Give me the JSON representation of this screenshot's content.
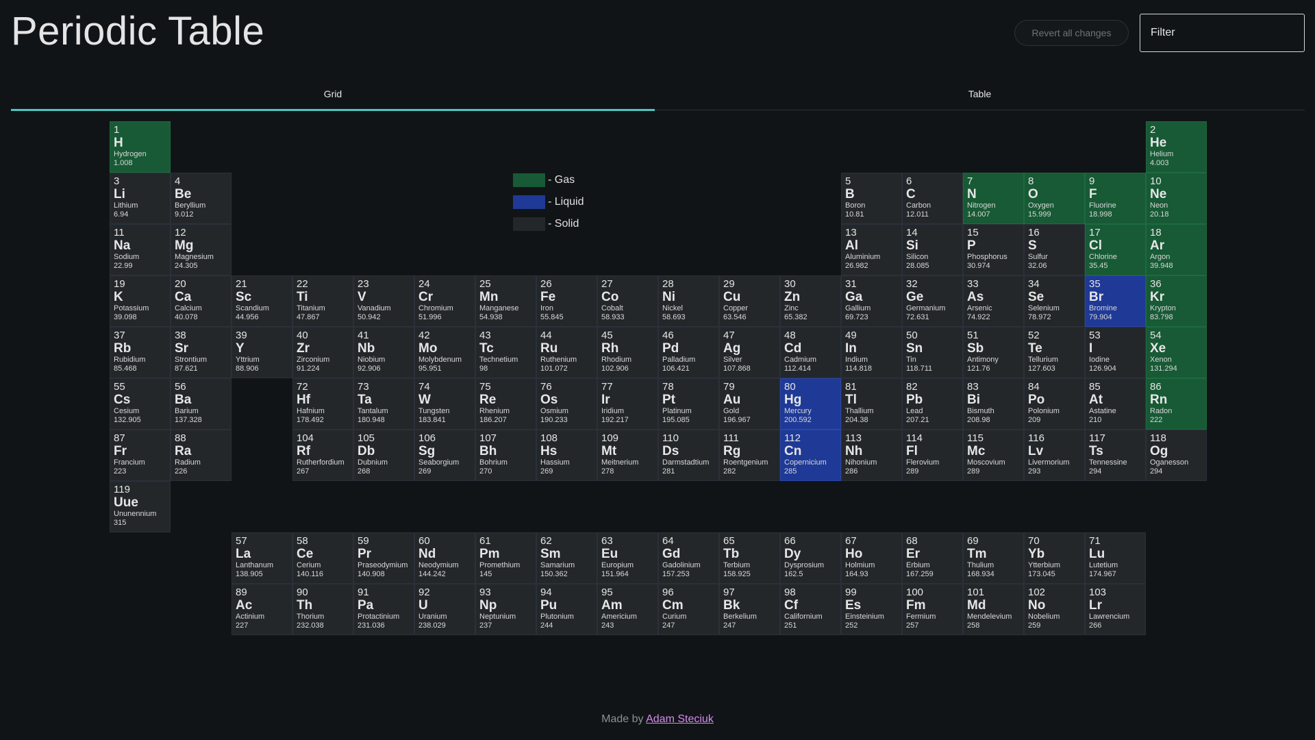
{
  "header": {
    "title": "Periodic Table",
    "revert_label": "Revert all changes",
    "filter_placeholder": "Filter"
  },
  "tabs": [
    {
      "label": "Grid",
      "active": true
    },
    {
      "label": "Table",
      "active": false
    }
  ],
  "legend": [
    {
      "label": "- Gas",
      "color": "#175a35"
    },
    {
      "label": "- Liquid",
      "color": "#1f3996"
    },
    {
      "label": "- Solid",
      "color": "#24272a"
    }
  ],
  "colors": {
    "gas": "#175a35",
    "liquid": "#1f3996",
    "solid": "#24272a",
    "accent": "#4dc6c0",
    "link": "#d68bf0"
  },
  "elements": [
    {
      "n": "1",
      "s": "H",
      "name": "Hydrogen",
      "m": "1.008",
      "state": "gas"
    },
    {
      "n": "2",
      "s": "He",
      "name": "Helium",
      "m": "4.003",
      "state": "gas"
    },
    {
      "n": "3",
      "s": "Li",
      "name": "Lithium",
      "m": "6.94",
      "state": "solid"
    },
    {
      "n": "4",
      "s": "Be",
      "name": "Beryllium",
      "m": "9.012",
      "state": "solid"
    },
    {
      "n": "5",
      "s": "B",
      "name": "Boron",
      "m": "10.81",
      "state": "solid"
    },
    {
      "n": "6",
      "s": "C",
      "name": "Carbon",
      "m": "12.011",
      "state": "solid"
    },
    {
      "n": "7",
      "s": "N",
      "name": "Nitrogen",
      "m": "14.007",
      "state": "gas"
    },
    {
      "n": "8",
      "s": "O",
      "name": "Oxygen",
      "m": "15.999",
      "state": "gas"
    },
    {
      "n": "9",
      "s": "F",
      "name": "Fluorine",
      "m": "18.998",
      "state": "gas"
    },
    {
      "n": "10",
      "s": "Ne",
      "name": "Neon",
      "m": "20.18",
      "state": "gas"
    },
    {
      "n": "11",
      "s": "Na",
      "name": "Sodium",
      "m": "22.99",
      "state": "solid"
    },
    {
      "n": "12",
      "s": "Mg",
      "name": "Magnesium",
      "m": "24.305",
      "state": "solid"
    },
    {
      "n": "13",
      "s": "Al",
      "name": "Aluminium",
      "m": "26.982",
      "state": "solid"
    },
    {
      "n": "14",
      "s": "Si",
      "name": "Silicon",
      "m": "28.085",
      "state": "solid"
    },
    {
      "n": "15",
      "s": "P",
      "name": "Phosphorus",
      "m": "30.974",
      "state": "solid"
    },
    {
      "n": "16",
      "s": "S",
      "name": "Sulfur",
      "m": "32.06",
      "state": "solid"
    },
    {
      "n": "17",
      "s": "Cl",
      "name": "Chlorine",
      "m": "35.45",
      "state": "gas"
    },
    {
      "n": "18",
      "s": "Ar",
      "name": "Argon",
      "m": "39.948",
      "state": "gas"
    },
    {
      "n": "19",
      "s": "K",
      "name": "Potassium",
      "m": "39.098",
      "state": "solid"
    },
    {
      "n": "20",
      "s": "Ca",
      "name": "Calcium",
      "m": "40.078",
      "state": "solid"
    },
    {
      "n": "21",
      "s": "Sc",
      "name": "Scandium",
      "m": "44.956",
      "state": "solid"
    },
    {
      "n": "22",
      "s": "Ti",
      "name": "Titanium",
      "m": "47.867",
      "state": "solid"
    },
    {
      "n": "23",
      "s": "V",
      "name": "Vanadium",
      "m": "50.942",
      "state": "solid"
    },
    {
      "n": "24",
      "s": "Cr",
      "name": "Chromium",
      "m": "51.996",
      "state": "solid"
    },
    {
      "n": "25",
      "s": "Mn",
      "name": "Manganese",
      "m": "54.938",
      "state": "solid"
    },
    {
      "n": "26",
      "s": "Fe",
      "name": "Iron",
      "m": "55.845",
      "state": "solid"
    },
    {
      "n": "27",
      "s": "Co",
      "name": "Cobalt",
      "m": "58.933",
      "state": "solid"
    },
    {
      "n": "28",
      "s": "Ni",
      "name": "Nickel",
      "m": "58.693",
      "state": "solid"
    },
    {
      "n": "29",
      "s": "Cu",
      "name": "Copper",
      "m": "63.546",
      "state": "solid"
    },
    {
      "n": "30",
      "s": "Zn",
      "name": "Zinc",
      "m": "65.382",
      "state": "solid"
    },
    {
      "n": "31",
      "s": "Ga",
      "name": "Gallium",
      "m": "69.723",
      "state": "solid"
    },
    {
      "n": "32",
      "s": "Ge",
      "name": "Germanium",
      "m": "72.631",
      "state": "solid"
    },
    {
      "n": "33",
      "s": "As",
      "name": "Arsenic",
      "m": "74.922",
      "state": "solid"
    },
    {
      "n": "34",
      "s": "Se",
      "name": "Selenium",
      "m": "78.972",
      "state": "solid"
    },
    {
      "n": "35",
      "s": "Br",
      "name": "Bromine",
      "m": "79.904",
      "state": "liquid"
    },
    {
      "n": "36",
      "s": "Kr",
      "name": "Krypton",
      "m": "83.798",
      "state": "gas"
    },
    {
      "n": "37",
      "s": "Rb",
      "name": "Rubidium",
      "m": "85.468",
      "state": "solid"
    },
    {
      "n": "38",
      "s": "Sr",
      "name": "Strontium",
      "m": "87.621",
      "state": "solid"
    },
    {
      "n": "39",
      "s": "Y",
      "name": "Yttrium",
      "m": "88.906",
      "state": "solid"
    },
    {
      "n": "40",
      "s": "Zr",
      "name": "Zirconium",
      "m": "91.224",
      "state": "solid"
    },
    {
      "n": "41",
      "s": "Nb",
      "name": "Niobium",
      "m": "92.906",
      "state": "solid"
    },
    {
      "n": "42",
      "s": "Mo",
      "name": "Molybdenum",
      "m": "95.951",
      "state": "solid"
    },
    {
      "n": "43",
      "s": "Tc",
      "name": "Technetium",
      "m": "98",
      "state": "solid"
    },
    {
      "n": "44",
      "s": "Ru",
      "name": "Ruthenium",
      "m": "101.072",
      "state": "solid"
    },
    {
      "n": "45",
      "s": "Rh",
      "name": "Rhodium",
      "m": "102.906",
      "state": "solid"
    },
    {
      "n": "46",
      "s": "Pd",
      "name": "Palladium",
      "m": "106.421",
      "state": "solid"
    },
    {
      "n": "47",
      "s": "Ag",
      "name": "Silver",
      "m": "107.868",
      "state": "solid"
    },
    {
      "n": "48",
      "s": "Cd",
      "name": "Cadmium",
      "m": "112.414",
      "state": "solid"
    },
    {
      "n": "49",
      "s": "In",
      "name": "Indium",
      "m": "114.818",
      "state": "solid"
    },
    {
      "n": "50",
      "s": "Sn",
      "name": "Tin",
      "m": "118.711",
      "state": "solid"
    },
    {
      "n": "51",
      "s": "Sb",
      "name": "Antimony",
      "m": "121.76",
      "state": "solid"
    },
    {
      "n": "52",
      "s": "Te",
      "name": "Tellurium",
      "m": "127.603",
      "state": "solid"
    },
    {
      "n": "53",
      "s": "I",
      "name": "Iodine",
      "m": "126.904",
      "state": "solid"
    },
    {
      "n": "54",
      "s": "Xe",
      "name": "Xenon",
      "m": "131.294",
      "state": "gas"
    },
    {
      "n": "55",
      "s": "Cs",
      "name": "Cesium",
      "m": "132.905",
      "state": "solid"
    },
    {
      "n": "56",
      "s": "Ba",
      "name": "Barium",
      "m": "137.328",
      "state": "solid"
    },
    {
      "n": "72",
      "s": "Hf",
      "name": "Hafnium",
      "m": "178.492",
      "state": "solid"
    },
    {
      "n": "73",
      "s": "Ta",
      "name": "Tantalum",
      "m": "180.948",
      "state": "solid"
    },
    {
      "n": "74",
      "s": "W",
      "name": "Tungsten",
      "m": "183.841",
      "state": "solid"
    },
    {
      "n": "75",
      "s": "Re",
      "name": "Rhenium",
      "m": "186.207",
      "state": "solid"
    },
    {
      "n": "76",
      "s": "Os",
      "name": "Osmium",
      "m": "190.233",
      "state": "solid"
    },
    {
      "n": "77",
      "s": "Ir",
      "name": "Iridium",
      "m": "192.217",
      "state": "solid"
    },
    {
      "n": "78",
      "s": "Pt",
      "name": "Platinum",
      "m": "195.085",
      "state": "solid"
    },
    {
      "n": "79",
      "s": "Au",
      "name": "Gold",
      "m": "196.967",
      "state": "solid"
    },
    {
      "n": "80",
      "s": "Hg",
      "name": "Mercury",
      "m": "200.592",
      "state": "liquid"
    },
    {
      "n": "81",
      "s": "Tl",
      "name": "Thallium",
      "m": "204.38",
      "state": "solid"
    },
    {
      "n": "82",
      "s": "Pb",
      "name": "Lead",
      "m": "207.21",
      "state": "solid"
    },
    {
      "n": "83",
      "s": "Bi",
      "name": "Bismuth",
      "m": "208.98",
      "state": "solid"
    },
    {
      "n": "84",
      "s": "Po",
      "name": "Polonium",
      "m": "209",
      "state": "solid"
    },
    {
      "n": "85",
      "s": "At",
      "name": "Astatine",
      "m": "210",
      "state": "solid"
    },
    {
      "n": "86",
      "s": "Rn",
      "name": "Radon",
      "m": "222",
      "state": "gas"
    },
    {
      "n": "87",
      "s": "Fr",
      "name": "Francium",
      "m": "223",
      "state": "solid"
    },
    {
      "n": "88",
      "s": "Ra",
      "name": "Radium",
      "m": "226",
      "state": "solid"
    },
    {
      "n": "104",
      "s": "Rf",
      "name": "Rutherfordium",
      "m": "267",
      "state": "solid"
    },
    {
      "n": "105",
      "s": "Db",
      "name": "Dubnium",
      "m": "268",
      "state": "solid"
    },
    {
      "n": "106",
      "s": "Sg",
      "name": "Seaborgium",
      "m": "269",
      "state": "solid"
    },
    {
      "n": "107",
      "s": "Bh",
      "name": "Bohrium",
      "m": "270",
      "state": "solid"
    },
    {
      "n": "108",
      "s": "Hs",
      "name": "Hassium",
      "m": "269",
      "state": "solid"
    },
    {
      "n": "109",
      "s": "Mt",
      "name": "Meitnerium",
      "m": "278",
      "state": "solid"
    },
    {
      "n": "110",
      "s": "Ds",
      "name": "Darmstadtium",
      "m": "281",
      "state": "solid"
    },
    {
      "n": "111",
      "s": "Rg",
      "name": "Roentgenium",
      "m": "282",
      "state": "solid"
    },
    {
      "n": "112",
      "s": "Cn",
      "name": "Copernicium",
      "m": "285",
      "state": "liquid"
    },
    {
      "n": "113",
      "s": "Nh",
      "name": "Nihonium",
      "m": "286",
      "state": "solid"
    },
    {
      "n": "114",
      "s": "Fl",
      "name": "Flerovium",
      "m": "289",
      "state": "solid"
    },
    {
      "n": "115",
      "s": "Mc",
      "name": "Moscovium",
      "m": "289",
      "state": "solid"
    },
    {
      "n": "116",
      "s": "Lv",
      "name": "Livermorium",
      "m": "293",
      "state": "solid"
    },
    {
      "n": "117",
      "s": "Ts",
      "name": "Tennessine",
      "m": "294",
      "state": "solid"
    },
    {
      "n": "118",
      "s": "Og",
      "name": "Oganesson",
      "m": "294",
      "state": "solid"
    },
    {
      "n": "119",
      "s": "Uue",
      "name": "Ununennium",
      "m": "315",
      "state": "solid"
    },
    {
      "n": "57",
      "s": "La",
      "name": "Lanthanum",
      "m": "138.905",
      "state": "solid"
    },
    {
      "n": "58",
      "s": "Ce",
      "name": "Cerium",
      "m": "140.116",
      "state": "solid"
    },
    {
      "n": "59",
      "s": "Pr",
      "name": "Praseodymium",
      "m": "140.908",
      "state": "solid"
    },
    {
      "n": "60",
      "s": "Nd",
      "name": "Neodymium",
      "m": "144.242",
      "state": "solid"
    },
    {
      "n": "61",
      "s": "Pm",
      "name": "Promethium",
      "m": "145",
      "state": "solid"
    },
    {
      "n": "62",
      "s": "Sm",
      "name": "Samarium",
      "m": "150.362",
      "state": "solid"
    },
    {
      "n": "63",
      "s": "Eu",
      "name": "Europium",
      "m": "151.964",
      "state": "solid"
    },
    {
      "n": "64",
      "s": "Gd",
      "name": "Gadolinium",
      "m": "157.253",
      "state": "solid"
    },
    {
      "n": "65",
      "s": "Tb",
      "name": "Terbium",
      "m": "158.925",
      "state": "solid"
    },
    {
      "n": "66",
      "s": "Dy",
      "name": "Dysprosium",
      "m": "162.5",
      "state": "solid"
    },
    {
      "n": "67",
      "s": "Ho",
      "name": "Holmium",
      "m": "164.93",
      "state": "solid"
    },
    {
      "n": "68",
      "s": "Er",
      "name": "Erbium",
      "m": "167.259",
      "state": "solid"
    },
    {
      "n": "69",
      "s": "Tm",
      "name": "Thulium",
      "m": "168.934",
      "state": "solid"
    },
    {
      "n": "70",
      "s": "Yb",
      "name": "Ytterbium",
      "m": "173.045",
      "state": "solid"
    },
    {
      "n": "71",
      "s": "Lu",
      "name": "Lutetium",
      "m": "174.967",
      "state": "solid"
    },
    {
      "n": "89",
      "s": "Ac",
      "name": "Actinium",
      "m": "227",
      "state": "solid"
    },
    {
      "n": "90",
      "s": "Th",
      "name": "Thorium",
      "m": "232.038",
      "state": "solid"
    },
    {
      "n": "91",
      "s": "Pa",
      "name": "Protactinium",
      "m": "231.036",
      "state": "solid"
    },
    {
      "n": "92",
      "s": "U",
      "name": "Uranium",
      "m": "238.029",
      "state": "solid"
    },
    {
      "n": "93",
      "s": "Np",
      "name": "Neptunium",
      "m": "237",
      "state": "solid"
    },
    {
      "n": "94",
      "s": "Pu",
      "name": "Plutonium",
      "m": "244",
      "state": "solid"
    },
    {
      "n": "95",
      "s": "Am",
      "name": "Americium",
      "m": "243",
      "state": "solid"
    },
    {
      "n": "96",
      "s": "Cm",
      "name": "Curium",
      "m": "247",
      "state": "solid"
    },
    {
      "n": "97",
      "s": "Bk",
      "name": "Berkelium",
      "m": "247",
      "state": "solid"
    },
    {
      "n": "98",
      "s": "Cf",
      "name": "Californium",
      "m": "251",
      "state": "solid"
    },
    {
      "n": "99",
      "s": "Es",
      "name": "Einsteinium",
      "m": "252",
      "state": "solid"
    },
    {
      "n": "100",
      "s": "Fm",
      "name": "Fermium",
      "m": "257",
      "state": "solid"
    },
    {
      "n": "101",
      "s": "Md",
      "name": "Mendelevium",
      "m": "258",
      "state": "solid"
    },
    {
      "n": "102",
      "s": "No",
      "name": "Nobelium",
      "m": "259",
      "state": "solid"
    },
    {
      "n": "103",
      "s": "Lr",
      "name": "Lawrencium",
      "m": "266",
      "state": "solid"
    }
  ],
  "footer": {
    "prefix": "Made by",
    "author": "Adam Steciuk"
  }
}
